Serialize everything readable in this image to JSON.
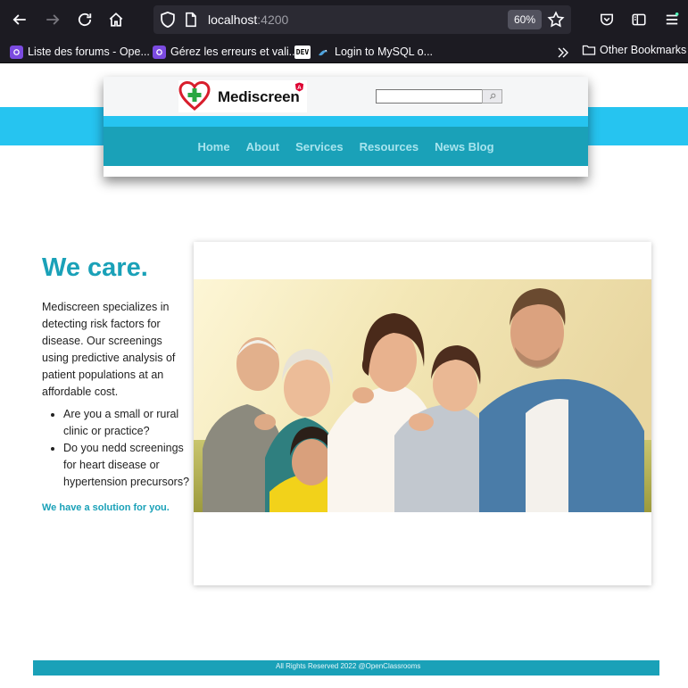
{
  "browser": {
    "url_host": "localhost",
    "url_port": ":4200",
    "zoom": "60%",
    "bookmarks": [
      {
        "label": "Liste des forums - Ope...",
        "icon": "openclassrooms-icon"
      },
      {
        "label": "Gérez les erreurs et vali...",
        "icon": "openclassrooms-icon"
      },
      {
        "label": "Login to MySQL o...",
        "icon": "mysql-icon"
      }
    ],
    "dev_badge": "DEV",
    "other_bookmarks": "Other Bookmarks"
  },
  "site": {
    "logo_text": "Mediscreen",
    "logo_badge": "A",
    "search": {
      "value": "",
      "placeholder": ""
    },
    "nav": [
      "Home",
      "About",
      "Services",
      "Resources",
      "News Blog"
    ]
  },
  "content": {
    "headline": "We care.",
    "intro": "Mediscreen specializes in detecting risk factors for disease. Our screenings using predictive analysis of patient populations at an affordable cost.",
    "bullets": [
      "Are you a small or rural clinic or practice?",
      "Do you nedd screenings for heart disease or hypertension precursors?"
    ],
    "tagline": "We have a solution for you."
  },
  "footer": {
    "text": "All Rights Reserved 2022 @OpenClassrooms"
  },
  "colors": {
    "brand_teal": "#1aa1b8",
    "accent_cyan": "#26c4f0",
    "nav_text": "#a7e4ee"
  }
}
